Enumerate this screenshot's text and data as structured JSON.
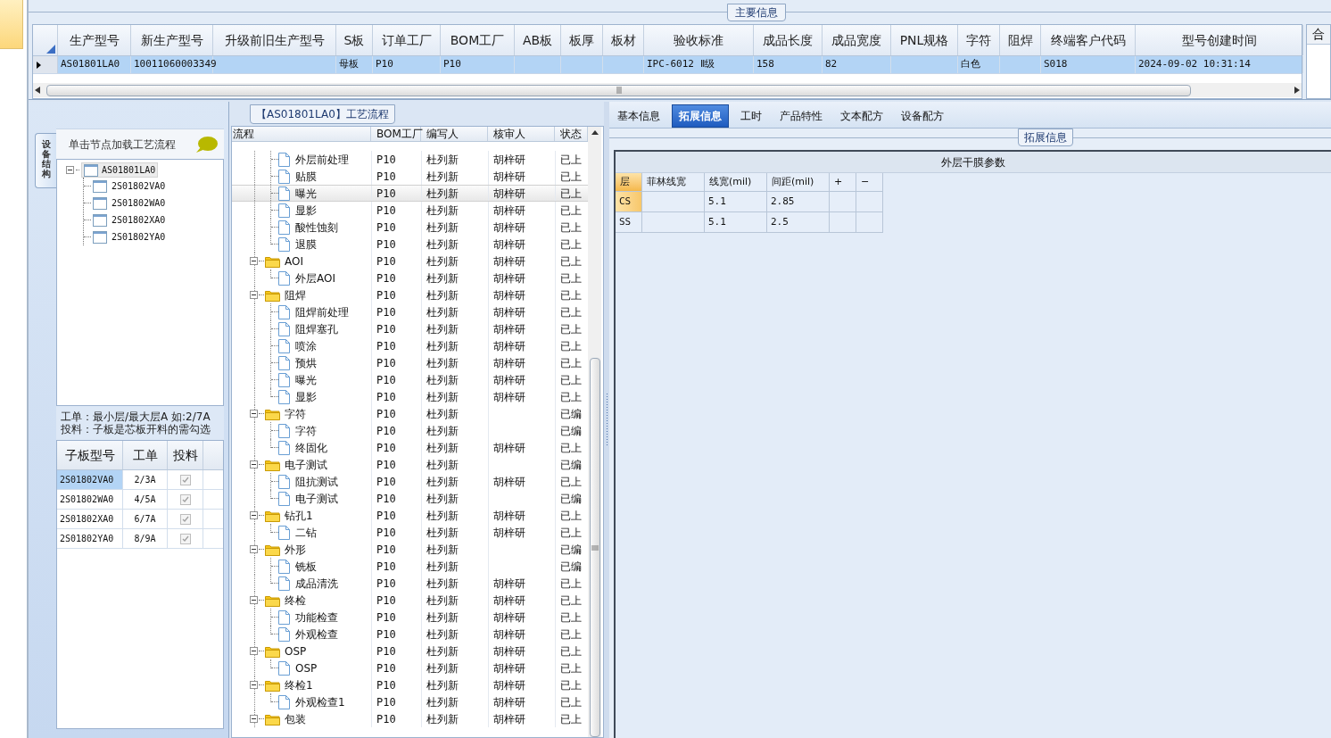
{
  "main_info": {
    "title": "主要信息",
    "columns": [
      "生产型号",
      "新生产型号",
      "升级前旧生产型号",
      "S板",
      "订单工厂",
      "BOM工厂",
      "AB板",
      "板厚",
      "板材",
      "验收标准",
      "成品长度",
      "成品宽度",
      "PNL规格",
      "字符",
      "阻焊",
      "终端客户代码",
      "型号创建时间"
    ],
    "rows": [
      {
        "selected": true,
        "cells": [
          "AS01801LA0",
          "10011060003349",
          null,
          "母板",
          "P10",
          "P10",
          null,
          null,
          null,
          "IPC-6012 Ⅱ级",
          "158",
          "82",
          null,
          "白色",
          null,
          "S018",
          "2024-09-02 10:31:14"
        ]
      }
    ],
    "side_header": "合"
  },
  "structure_panel": {
    "tab": "设备结构",
    "hint": "单击节点加载工艺流程",
    "tree": [
      {
        "label": "AS01801LA0",
        "selected": true,
        "expanded": true,
        "children": [
          {
            "label": "2S01802VA0",
            "selected": false
          },
          {
            "label": "2S01802WA0",
            "selected": false
          },
          {
            "label": "2S01802XA0",
            "selected": false
          },
          {
            "label": "2S01802YA0",
            "selected": false
          }
        ]
      }
    ],
    "note": [
      "工单：最小层/最大层A 如:2/7A",
      "投料：子板是芯板开料的需勾选"
    ],
    "grid": {
      "columns": [
        "子板型号",
        "工单",
        "投料"
      ],
      "rows": [
        {
          "model": "2S01802VA0",
          "order": "2/3A",
          "feed": true,
          "selected": true
        },
        {
          "model": "2S01802WA0",
          "order": "4/5A",
          "feed": true,
          "selected": false
        },
        {
          "model": "2S01802XA0",
          "order": "6/7A",
          "feed": true,
          "selected": false
        },
        {
          "model": "2S01802YA0",
          "order": "8/9A",
          "feed": true,
          "selected": false
        }
      ]
    }
  },
  "process_panel": {
    "title": "【AS01801LA0】工艺流程",
    "columns": [
      "流程",
      "BOM工厂",
      "编写人",
      "核审人",
      "状态"
    ],
    "items": [
      {
        "kind": "continuation",
        "children": [
          {
            "kind": "step",
            "label": "外层前处理",
            "bom": "P10",
            "writer": "杜列新",
            "reviewer": "胡梓研",
            "status": "已上",
            "selected": false
          },
          {
            "kind": "step",
            "label": "贴膜",
            "bom": "P10",
            "writer": "杜列新",
            "reviewer": "胡梓研",
            "status": "已上",
            "selected": false
          },
          {
            "kind": "step",
            "label": "曝光",
            "bom": "P10",
            "writer": "杜列新",
            "reviewer": "胡梓研",
            "status": "已上",
            "selected": true
          },
          {
            "kind": "step",
            "label": "显影",
            "bom": "P10",
            "writer": "杜列新",
            "reviewer": "胡梓研",
            "status": "已上",
            "selected": false
          },
          {
            "kind": "step",
            "label": "酸性蚀刻",
            "bom": "P10",
            "writer": "杜列新",
            "reviewer": "胡梓研",
            "status": "已上",
            "selected": false
          },
          {
            "kind": "step",
            "label": "退膜",
            "bom": "P10",
            "writer": "杜列新",
            "reviewer": "胡梓研",
            "status": "已上",
            "selected": false
          }
        ]
      },
      {
        "kind": "folder",
        "label": "AOI",
        "bom": "P10",
        "writer": "杜列新",
        "reviewer": "胡梓研",
        "status": "已上",
        "selected": false,
        "expanded": true,
        "children": [
          {
            "kind": "step",
            "label": "外层AOI",
            "bom": "P10",
            "writer": "杜列新",
            "reviewer": "胡梓研",
            "status": "已上",
            "selected": false
          }
        ]
      },
      {
        "kind": "folder",
        "label": "阻焊",
        "bom": "P10",
        "writer": "杜列新",
        "reviewer": "胡梓研",
        "status": "已上",
        "selected": false,
        "expanded": true,
        "children": [
          {
            "kind": "step",
            "label": "阻焊前处理",
            "bom": "P10",
            "writer": "杜列新",
            "reviewer": "胡梓研",
            "status": "已上",
            "selected": false
          },
          {
            "kind": "step",
            "label": "阻焊塞孔",
            "bom": "P10",
            "writer": "杜列新",
            "reviewer": "胡梓研",
            "status": "已上",
            "selected": false
          },
          {
            "kind": "step",
            "label": "喷涂",
            "bom": "P10",
            "writer": "杜列新",
            "reviewer": "胡梓研",
            "status": "已上",
            "selected": false
          },
          {
            "kind": "step",
            "label": "预烘",
            "bom": "P10",
            "writer": "杜列新",
            "reviewer": "胡梓研",
            "status": "已上",
            "selected": false
          },
          {
            "kind": "step",
            "label": "曝光",
            "bom": "P10",
            "writer": "杜列新",
            "reviewer": "胡梓研",
            "status": "已上",
            "selected": false
          },
          {
            "kind": "step",
            "label": "显影",
            "bom": "P10",
            "writer": "杜列新",
            "reviewer": "胡梓研",
            "status": "已上",
            "selected": false
          }
        ]
      },
      {
        "kind": "folder",
        "label": "字符",
        "bom": "P10",
        "writer": "杜列新",
        "status": "已编",
        "selected": false,
        "expanded": true,
        "children": [
          {
            "kind": "step",
            "label": "字符",
            "bom": "P10",
            "writer": "杜列新",
            "status": "已编",
            "selected": false
          },
          {
            "kind": "step",
            "label": "终固化",
            "bom": "P10",
            "writer": "杜列新",
            "reviewer": "胡梓研",
            "status": "已上",
            "selected": false
          }
        ]
      },
      {
        "kind": "folder",
        "label": "电子测试",
        "bom": "P10",
        "writer": "杜列新",
        "status": "已编",
        "selected": false,
        "expanded": true,
        "children": [
          {
            "kind": "step",
            "label": "阻抗测试",
            "bom": "P10",
            "writer": "杜列新",
            "reviewer": "胡梓研",
            "status": "已上",
            "selected": false
          },
          {
            "kind": "step",
            "label": "电子测试",
            "bom": "P10",
            "writer": "杜列新",
            "status": "已编",
            "selected": false
          }
        ]
      },
      {
        "kind": "folder",
        "label": "钻孔1",
        "bom": "P10",
        "writer": "杜列新",
        "reviewer": "胡梓研",
        "status": "已上",
        "selected": false,
        "expanded": true,
        "children": [
          {
            "kind": "step",
            "label": "二钻",
            "bom": "P10",
            "writer": "杜列新",
            "reviewer": "胡梓研",
            "status": "已上",
            "selected": false
          }
        ]
      },
      {
        "kind": "folder",
        "label": "外形",
        "bom": "P10",
        "writer": "杜列新",
        "status": "已编",
        "selected": false,
        "expanded": true,
        "children": [
          {
            "kind": "step",
            "label": "铣板",
            "bom": "P10",
            "writer": "杜列新",
            "status": "已编",
            "selected": false
          },
          {
            "kind": "step",
            "label": "成品清洗",
            "bom": "P10",
            "writer": "杜列新",
            "reviewer": "胡梓研",
            "status": "已上",
            "selected": false
          }
        ]
      },
      {
        "kind": "folder",
        "label": "终检",
        "bom": "P10",
        "writer": "杜列新",
        "reviewer": "胡梓研",
        "status": "已上",
        "selected": false,
        "expanded": true,
        "children": [
          {
            "kind": "step",
            "label": "功能检查",
            "bom": "P10",
            "writer": "杜列新",
            "reviewer": "胡梓研",
            "status": "已上",
            "selected": false
          },
          {
            "kind": "step",
            "label": "外观检查",
            "bom": "P10",
            "writer": "杜列新",
            "reviewer": "胡梓研",
            "status": "已上",
            "selected": false
          }
        ]
      },
      {
        "kind": "folder",
        "label": "OSP",
        "bom": "P10",
        "writer": "杜列新",
        "reviewer": "胡梓研",
        "status": "已上",
        "selected": false,
        "expanded": true,
        "children": [
          {
            "kind": "step",
            "label": "OSP",
            "bom": "P10",
            "writer": "杜列新",
            "reviewer": "胡梓研",
            "status": "已上",
            "selected": false
          }
        ]
      },
      {
        "kind": "folder",
        "label": "终检1",
        "bom": "P10",
        "writer": "杜列新",
        "reviewer": "胡梓研",
        "status": "已上",
        "selected": false,
        "expanded": true,
        "children": [
          {
            "kind": "step",
            "label": "外观检查1",
            "bom": "P10",
            "writer": "杜列新",
            "reviewer": "胡梓研",
            "status": "已上",
            "selected": false
          }
        ]
      },
      {
        "kind": "folder",
        "label": "包装",
        "bom": "P10",
        "writer": "杜列新",
        "reviewer": "胡梓研",
        "status": "已上",
        "selected": false,
        "expanded": true
      }
    ]
  },
  "detail_panel": {
    "tabs": [
      {
        "label": "基本信息",
        "selected": false
      },
      {
        "label": "拓展信息",
        "selected": true
      },
      {
        "label": "工时",
        "selected": false
      },
      {
        "label": "产品特性",
        "selected": false
      },
      {
        "label": "文本配方",
        "selected": false
      },
      {
        "label": "设备配方",
        "selected": false
      }
    ],
    "group_title": "拓展信息",
    "table": {
      "title": "外层干膜参数",
      "columns": [
        "层",
        "菲林线宽",
        "线宽(mil)",
        "间距(mil)",
        "+",
        "−"
      ],
      "rows": [
        {
          "selected": true,
          "cells": [
            "CS",
            null,
            "5.1",
            "2.85",
            null,
            null
          ]
        },
        {
          "selected": false,
          "cells": [
            "SS",
            null,
            "5.1",
            "2.5",
            null,
            null
          ]
        }
      ]
    }
  }
}
